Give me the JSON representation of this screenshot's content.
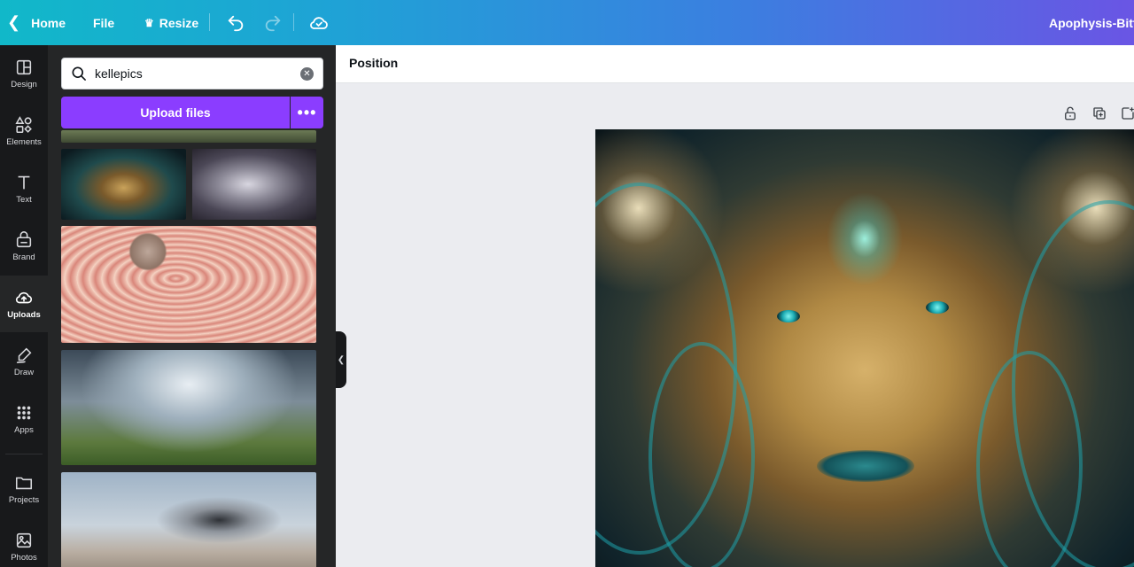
{
  "topbar": {
    "home_label": "Home",
    "file_label": "File",
    "resize_label": "Resize",
    "title": "Apophysis-Bitte"
  },
  "rail": {
    "items": [
      {
        "label": "Design",
        "icon": "layout-icon"
      },
      {
        "label": "Elements",
        "icon": "shapes-icon"
      },
      {
        "label": "Text",
        "icon": "text-icon"
      },
      {
        "label": "Brand",
        "icon": "brand-icon"
      },
      {
        "label": "Uploads",
        "icon": "cloud-upload-icon",
        "active": true
      },
      {
        "label": "Draw",
        "icon": "draw-icon"
      },
      {
        "label": "Apps",
        "icon": "apps-icon"
      },
      {
        "label": "Projects",
        "icon": "folder-icon"
      },
      {
        "label": "Photos",
        "icon": "image-icon"
      }
    ]
  },
  "panel": {
    "search": {
      "value": "kellepics"
    },
    "upload_label": "Upload files",
    "more_label": "•••"
  },
  "editor": {
    "position_label": "Position"
  },
  "colors": {
    "accent": "#8b3dff",
    "topbar_start": "#11b8c9",
    "topbar_end": "#6a55e4",
    "rail_bg": "#18191b",
    "panel_bg": "#252627"
  }
}
